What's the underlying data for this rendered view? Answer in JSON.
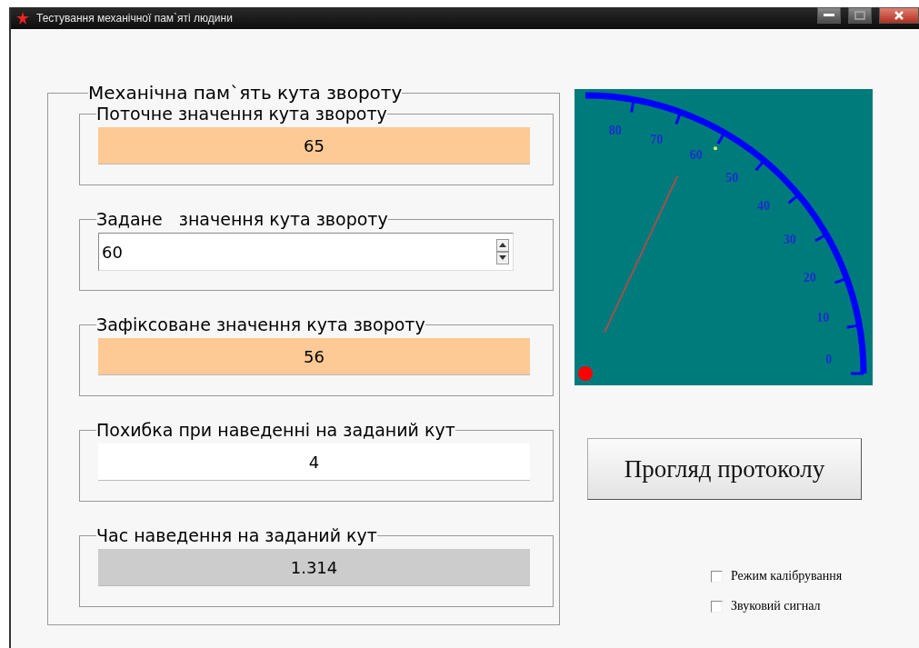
{
  "window": {
    "title": "Тестування механічної пам`яті людини"
  },
  "group": {
    "title": "Механічна пам`ять кута звороту",
    "sections": [
      {
        "kind": "readout",
        "label": "Поточне значення кута звороту",
        "value": "65",
        "color": "#fdc994"
      },
      {
        "kind": "spin",
        "label": "Задане   значення кута звороту",
        "value": "60"
      },
      {
        "kind": "readout",
        "label": "Зафіксоване значення кута звороту",
        "value": "56",
        "color": "#fdc994"
      },
      {
        "kind": "readout",
        "label": "Похибка при наведенні на заданий кут",
        "value": "4",
        "color": "#ffffff"
      },
      {
        "kind": "readout",
        "label": "Час наведення на заданий кут",
        "value": "1.314",
        "color": "#cccccc"
      }
    ]
  },
  "gauge": {
    "ticks": [
      "0",
      "10",
      "20",
      "30",
      "40",
      "50",
      "60",
      "70",
      "80"
    ]
  },
  "protocol_button": {
    "label": "Прогляд протоколу"
  },
  "options": [
    {
      "label": "Режим калібрування",
      "checked": false
    },
    {
      "label": "Звуковий сигнал",
      "checked": false
    }
  ]
}
